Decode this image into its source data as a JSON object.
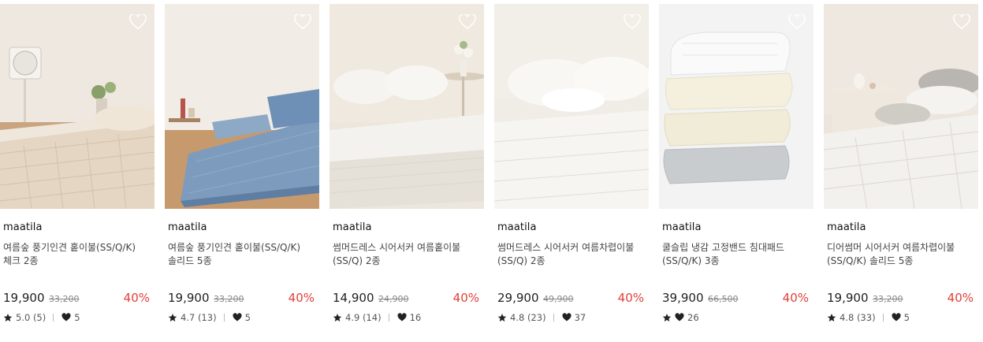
{
  "colors": {
    "discount": "#e2403a",
    "text": "#222222",
    "muted": "#888888"
  },
  "icons": {
    "wishlist": "heart-outline-icon",
    "rating": "star-icon",
    "likes": "heart-filled-icon"
  },
  "products": [
    {
      "brand": "maatila",
      "name": "여름숲 풍기인견 홑이불(SS/Q/K) 체크 2종",
      "price": "19,900",
      "original_price": "33,200",
      "discount": "40%",
      "rating": "5.0 (5)",
      "likes": "5",
      "has_rating": true
    },
    {
      "brand": "maatila",
      "name": "여름숲 풍기인견 홑이불(SS/Q/K) 솔리드 5종",
      "price": "19,900",
      "original_price": "33,200",
      "discount": "40%",
      "rating": "4.7 (13)",
      "likes": "5",
      "has_rating": true
    },
    {
      "brand": "maatila",
      "name": "썸머드레스 시어서커 여름홑이불(SS/Q) 2종",
      "price": "14,900",
      "original_price": "24,900",
      "discount": "40%",
      "rating": "4.9 (14)",
      "likes": "16",
      "has_rating": true
    },
    {
      "brand": "maatila",
      "name": "썸머드레스 시어서커 여름차렵이불(SS/Q) 2종",
      "price": "29,900",
      "original_price": "49,900",
      "discount": "40%",
      "rating": "4.8 (23)",
      "likes": "37",
      "has_rating": true
    },
    {
      "brand": "maatila",
      "name": "쿨슬립 냉감 고정밴드 침대패드(SS/Q/K) 3종",
      "price": "39,900",
      "original_price": "66,500",
      "discount": "40%",
      "rating": "",
      "likes": "26",
      "has_rating": false
    },
    {
      "brand": "maatila",
      "name": "디어썸머 시어서커 여름차렵이불(SS/Q/K) 솔리드 5종",
      "price": "19,900",
      "original_price": "33,200",
      "discount": "40%",
      "rating": "4.8 (33)",
      "likes": "5",
      "has_rating": true
    }
  ]
}
